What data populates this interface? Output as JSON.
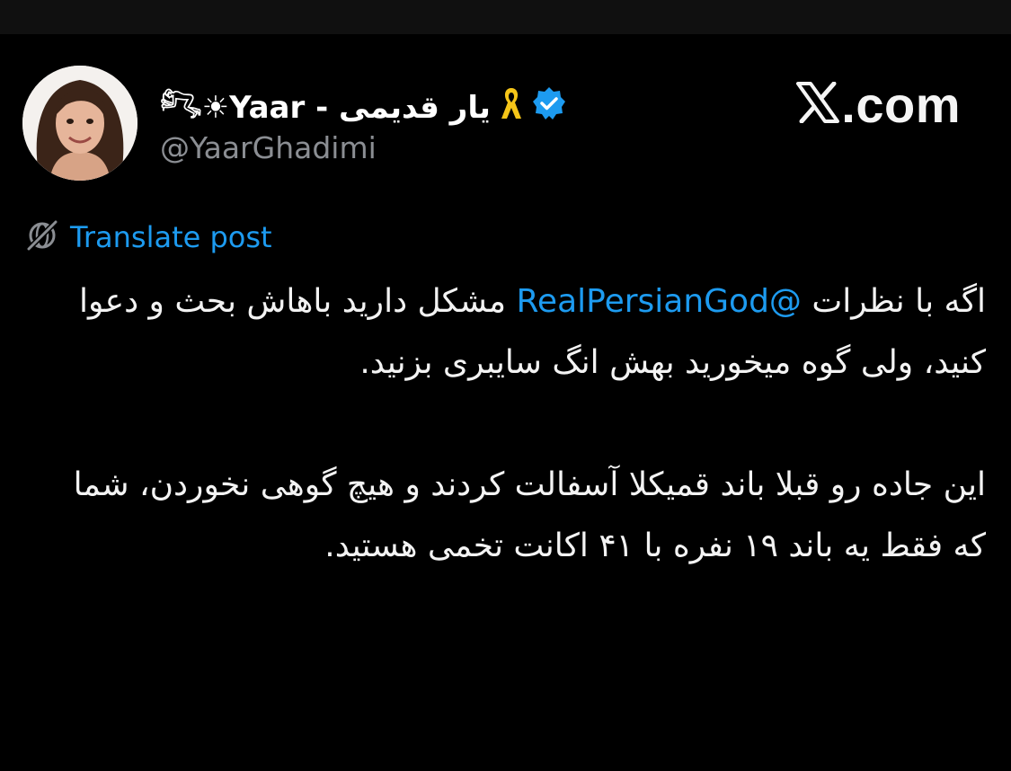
{
  "profile": {
    "display_name": "𓀐☀Yaar - یار قدیمی",
    "handle": "@YaarGhadimi"
  },
  "icons": {
    "avatar": "avatar-portrait",
    "ribbon": "yellow-ribbon-icon",
    "verified": "verified-badge-icon",
    "brand": "x-logo-icon",
    "translate": "globe-slash-icon"
  },
  "brand": {
    "text": ".com"
  },
  "translate": {
    "label": "Translate post"
  },
  "post": {
    "p1_before": "اگه با نظرات ",
    "mention": "@RealPersianGod",
    "p1_after": " مشکل دارید باهاش بحث و دعوا کنید، ولی گوه میخورید بهش انگ سایبری بزنید.",
    "p2": "این جاده رو قبلا باند قمیکلا آسفالت کردند و هیچ گوهی نخوردن، شما که فقط یه باند ۱۹ نفره با ۴۱ اکانت تخمی هستید."
  },
  "colors": {
    "background": "#000000",
    "link": "#1d9bf0",
    "muted": "#8b8e93",
    "ribbon": "#f5c518",
    "verified": "#1d9bf0"
  }
}
